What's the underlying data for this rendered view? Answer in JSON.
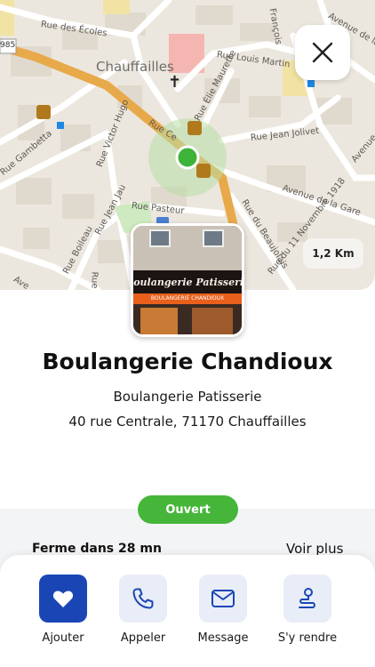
{
  "map": {
    "town": "Chauffailles",
    "road_number": "985",
    "streets": {
      "ecoles": "Rue des Écoles",
      "louis_martin": "Rue Louis Martin",
      "francois": "François",
      "avenue_gare_top": "Avenue de la G",
      "elie_maurette": "Rue Élie Maurette",
      "victor_hugo": "Rue Victor Hugo",
      "rue_ce": "Rue Ce",
      "gambetta": "Rue Gambetta",
      "jean_jolivet": "Rue Jean Jolivet",
      "avenue": "Avenue",
      "avenue_gare": "Avenue de la Gare",
      "pasteur": "Rue Pasteur",
      "jean_jau": "Rue Jean Jau",
      "boileau": "Rue Boileau",
      "du_beaujolais": "Rue du Beaujolais",
      "rue_de": "Rue de",
      "onze_novembre": "Rue du 11 Novembre 1918",
      "ave": "Ave"
    },
    "distance": "1,2 Km",
    "colors": {
      "location_dot": "#3db33a",
      "route": "#e8a94a"
    }
  },
  "store": {
    "photo_sign": "Boulangerie Patisserie",
    "photo_awning": "BOULANGERIE CHANDIOUX",
    "name": "Boulangerie Chandioux",
    "type": "Boulangerie Patisserie",
    "address": "40 rue Centrale, 71170 Chauffailles"
  },
  "status": {
    "badge": "Ouvert",
    "badge_color": "#46b63a",
    "closing": "Ferme dans 28 mn",
    "see_more": "Voir plus"
  },
  "actions": [
    {
      "label": "Ajouter",
      "icon": "heart-icon"
    },
    {
      "label": "Appeler",
      "icon": "phone-icon"
    },
    {
      "label": "Message",
      "icon": "mail-icon"
    },
    {
      "label": "S'y rendre",
      "icon": "directions-icon"
    }
  ],
  "colors": {
    "primary": "#1a46b5",
    "action_bg": "#e8edf7"
  }
}
